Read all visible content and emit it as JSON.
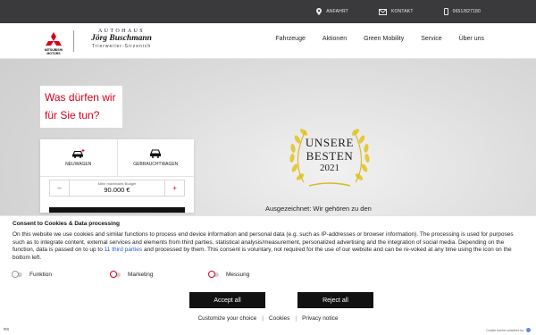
{
  "topbar": {
    "items": [
      {
        "label": "ANFAHRT",
        "icon": "location-pin-icon"
      },
      {
        "label": "KONTAKT",
        "icon": "mail-icon"
      },
      {
        "label": "0651/827180",
        "icon": "phone-icon"
      }
    ]
  },
  "header": {
    "brand": "MITSUBISHI MOTORS",
    "dealer_line1": "AUTOHAUS",
    "dealer_line2": "Jörg Buschmann",
    "dealer_line3": "Trierweiler-Sirzenich",
    "nav": [
      "Fahrzeuge",
      "Aktionen",
      "Green Mobility",
      "Service",
      "Über uns"
    ]
  },
  "hero": {
    "title_line1": "Was dürfen wir",
    "title_line2": "für Sie tun?",
    "tabs": [
      {
        "label": "NEUWAGEN",
        "icon": "new-car-icon"
      },
      {
        "label": "GEBRAUCHTWAGEN",
        "icon": "used-car-icon"
      }
    ],
    "budget_label": "Mein maximales Budget",
    "budget_value": "90.000 €",
    "minus": "–",
    "plus": "+",
    "award_line1": "UNSERE",
    "award_line2": "BESTEN",
    "award_line3": "2021",
    "teaser": "Ausgezeichnet: Wir gehören zu den"
  },
  "consent": {
    "title": "Consent to Cookies & Data processing",
    "text_before_link": "On this website we use cookies and similar functions to process end device information and personal data (e.g. such as IP-addresses or browser information). The processing is used for purposes such as to integrate content, external services and elements from third parties, statistical analysis/measurement, personalized advertising and the integration of social media. Depending on the function, data is passed on to up to ",
    "link_text": "11 third parties",
    "text_after_link": " and processed by them. This consent is voluntary, not required for the use of our website and can be re-voked at any time using the icon on the bottom left.",
    "toggles": [
      "Funktion",
      "Marketing",
      "Messung"
    ],
    "accept": "Accept all",
    "reject": "Reject all",
    "links": [
      "Customize your choice",
      "Privacy notice"
    ],
    "links_mid": "Cookies",
    "sep": "|",
    "footer_left": "RS",
    "footer_right": "Cookie banner powered by"
  },
  "colors": {
    "accent": "#d6001c",
    "topbar": "#3a3a3c",
    "button": "#111111",
    "link": "#1f5bd6"
  }
}
